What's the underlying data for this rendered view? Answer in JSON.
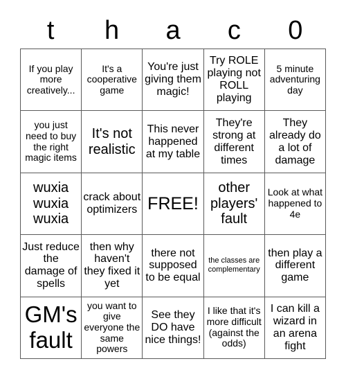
{
  "card": {
    "title_letters": [
      "t",
      "h",
      "a",
      "c",
      "0"
    ],
    "free_space_index": 12,
    "colors": {
      "background": "#ffffff",
      "text": "#000000",
      "grid_line": "#5a5a5a"
    },
    "cells": [
      {
        "text": "If you play more creatively...",
        "size": "fs-s"
      },
      {
        "text": "It's a cooperative game",
        "size": "fs-s"
      },
      {
        "text": "You're just giving them magic!",
        "size": "fs-m"
      },
      {
        "text": "Try ROLE playing not ROLL playing",
        "size": "fs-m"
      },
      {
        "text": "5 minute adventuring day",
        "size": "fs-s"
      },
      {
        "text": "you just need to buy the right magic items",
        "size": "fs-s"
      },
      {
        "text": "It's not realistic",
        "size": "fs-l"
      },
      {
        "text": "This never happened at my table",
        "size": "fs-m"
      },
      {
        "text": "They're strong at different times",
        "size": "fs-m"
      },
      {
        "text": "They already do a lot of damage",
        "size": "fs-m"
      },
      {
        "text": "wuxia wuxia wuxia",
        "size": "fs-l"
      },
      {
        "text": "crack about optimizers",
        "size": "fs-m"
      },
      {
        "text": "FREE!",
        "size": "fs-xl"
      },
      {
        "text": "other players' fault",
        "size": "fs-l"
      },
      {
        "text": "Look at what happened to 4e",
        "size": "fs-s"
      },
      {
        "text": "Just reduce the damage of spells",
        "size": "fs-m"
      },
      {
        "text": "then why haven't they fixed it yet",
        "size": "fs-m"
      },
      {
        "text": "there not supposed to be equal",
        "size": "fs-m"
      },
      {
        "text": "the classes are complementary",
        "size": "fs-xs"
      },
      {
        "text": "then play a different game",
        "size": "fs-m"
      },
      {
        "text": "GM's fault",
        "size": "fs-xxl"
      },
      {
        "text": "you want to give everyone the same powers",
        "size": "fs-s"
      },
      {
        "text": "See they DO have nice things!",
        "size": "fs-m"
      },
      {
        "text": "I like that it's more difficult (against the odds)",
        "size": "fs-s"
      },
      {
        "text": "I can kill a wizard in an arena fight",
        "size": "fs-m"
      }
    ]
  }
}
